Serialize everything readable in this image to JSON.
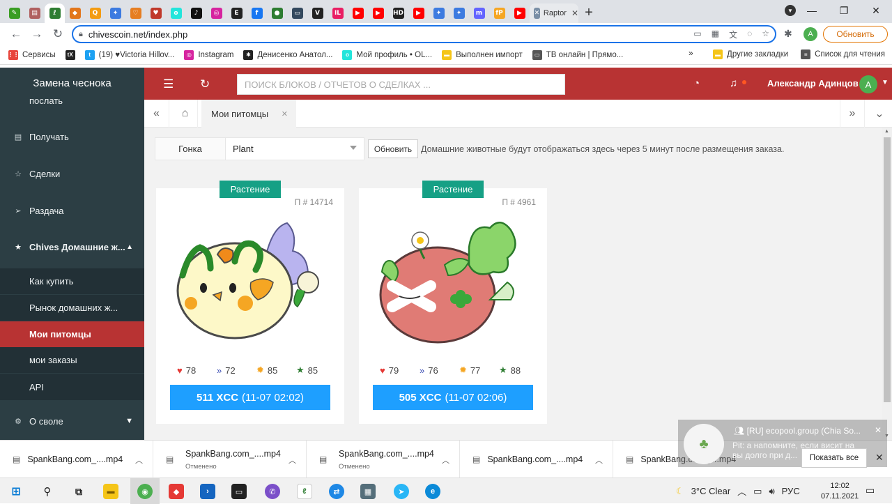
{
  "browser": {
    "tabs": [
      {
        "icon": "tab-favicon-leaf",
        "color": "#3a9d23",
        "glyph": "✎"
      },
      {
        "icon": "tab-favicon-doc",
        "color": "#b06060",
        "glyph": "▤"
      },
      {
        "icon": "tab-favicon-chives",
        "color": "#2e7d32",
        "glyph": "ℓ"
      },
      {
        "icon": "tab-favicon-metamask",
        "color": "#e2761b",
        "glyph": "◆"
      },
      {
        "icon": "tab-favicon-q",
        "color": "#f39c12",
        "glyph": "Q"
      },
      {
        "icon": "tab-favicon-butterfly",
        "color": "#3d7be0",
        "glyph": "✦"
      },
      {
        "icon": "tab-favicon-heart-orange",
        "color": "#e67e22",
        "glyph": "♡"
      },
      {
        "icon": "tab-favicon-heart",
        "color": "#c0392b",
        "glyph": "♥"
      },
      {
        "icon": "tab-favicon-olx",
        "color": "#23e5db",
        "glyph": "o"
      },
      {
        "icon": "tab-favicon-tiktok",
        "color": "#111111",
        "glyph": "♪"
      },
      {
        "icon": "tab-favicon-instagram",
        "color": "#d6249f",
        "glyph": "◎"
      },
      {
        "icon": "tab-favicon-e",
        "color": "#222222",
        "glyph": "E"
      },
      {
        "icon": "tab-favicon-facebook",
        "color": "#1877f2",
        "glyph": "f"
      },
      {
        "icon": "tab-favicon-green",
        "color": "#2e7d32",
        "glyph": "●"
      },
      {
        "icon": "tab-favicon-monitor",
        "color": "#34495e",
        "glyph": "▭"
      },
      {
        "icon": "tab-favicon-v",
        "color": "#222222",
        "glyph": "V"
      },
      {
        "icon": "tab-favicon-il",
        "color": "#e91e63",
        "glyph": "IL"
      },
      {
        "icon": "tab-favicon-youtube",
        "color": "#ff0000",
        "glyph": "▶"
      },
      {
        "icon": "tab-favicon-youtube",
        "color": "#ff0000",
        "glyph": "▶"
      },
      {
        "icon": "tab-favicon-hd",
        "color": "#222222",
        "glyph": "HD"
      },
      {
        "icon": "tab-favicon-youtube",
        "color": "#ff0000",
        "glyph": "▶"
      },
      {
        "icon": "tab-favicon-butterfly",
        "color": "#3d7be0",
        "glyph": "✦"
      },
      {
        "icon": "tab-favicon-butterfly",
        "color": "#3d7be0",
        "glyph": "✦"
      },
      {
        "icon": "tab-favicon-mastodon",
        "color": "#6364ff",
        "glyph": "m"
      },
      {
        "icon": "tab-favicon-fp",
        "color": "#f5a623",
        "glyph": "fP"
      },
      {
        "icon": "tab-favicon-youtube",
        "color": "#ff0000",
        "glyph": "▶"
      }
    ],
    "last_tab_title": "Raptor",
    "url": "chivescoin.net/index.php",
    "profile_initial": "A",
    "update_label": "Обновить",
    "bookmarks": [
      {
        "label": "Сервисы",
        "icon": "apps-grid-icon",
        "color": "#e8453c",
        "glyph": "⋮⋮"
      },
      {
        "label": "",
        "icon": "tx-icon",
        "color": "#222222",
        "glyph": "tX"
      },
      {
        "label": "(19) ♥Victoria Hillov...",
        "icon": "twitter-icon",
        "color": "#1da1f2",
        "glyph": "t"
      },
      {
        "label": "Instagram",
        "icon": "instagram-icon",
        "color": "#d6249f",
        "glyph": "◎"
      },
      {
        "label": "Денисенко Анатол...",
        "icon": "puzzle-icon",
        "color": "#222222",
        "glyph": "✱"
      },
      {
        "label": "Мой профиль • OL...",
        "icon": "olx-icon",
        "color": "#23e5db",
        "glyph": "o"
      },
      {
        "label": "Выполнен импорт",
        "icon": "folder-icon",
        "color": "#f5c518",
        "glyph": "▬"
      },
      {
        "label": "ТВ онлайн | Прямо...",
        "icon": "tv-icon",
        "color": "#555555",
        "glyph": "▭"
      }
    ],
    "bookmarks_right": [
      {
        "label": "Другие закладки",
        "icon": "folder-icon",
        "color": "#f5c518",
        "glyph": "▬"
      },
      {
        "label": "Список для чтения",
        "icon": "reading-list-icon",
        "color": "#555555",
        "glyph": "≡"
      }
    ]
  },
  "app": {
    "brand": "Замена чеснока",
    "search_placeholder": "ПОИСК БЛОКОВ / ОТЧЕТОВ О СДЕЛКАХ ...",
    "user_name": "Александр Адинцов",
    "user_initial": "A",
    "sidebar": {
      "partial_item": "послать",
      "items": [
        {
          "label": "Получать",
          "icon": "receive-icon"
        },
        {
          "label": "Сделки",
          "icon": "star-icon"
        },
        {
          "label": "Раздача",
          "icon": "send-icon"
        },
        {
          "label": "Chives Домашние ж...",
          "icon": "star-icon"
        }
      ],
      "sub_items": [
        "Как купить",
        "Рынок домашних ж...",
        "Мои питомцы",
        "мои заказы",
        "API"
      ],
      "bottom_item": "О своле"
    },
    "tabs": {
      "active": "Мои питомцы"
    },
    "filter": {
      "label": "Гонка",
      "value": "Plant",
      "refresh": "Обновить",
      "note": "Домашние животные будут отображаться здесь через 5 минут после размещения заказа."
    },
    "pets": [
      {
        "badge": "Растение",
        "pid": "П # 14714",
        "hp": "78",
        "speed": "72",
        "energy": "85",
        "luck": "85",
        "price": "511 XCC",
        "time": "(11-07 02:02)"
      },
      {
        "badge": "Растение",
        "pid": "П # 4961",
        "hp": "79",
        "speed": "76",
        "energy": "77",
        "luck": "88",
        "price": "505 XCC",
        "time": "(11-07 02:06)"
      }
    ],
    "colors": {
      "header": "#b83333",
      "sidebar": "#2c3e44",
      "badge": "#16a085",
      "price": "#1e9fff"
    }
  },
  "downloads": {
    "items": [
      {
        "name": "SpankBang.com_....mp4",
        "status": ""
      },
      {
        "name": "SpankBang.com_....mp4",
        "status": "Отменено"
      },
      {
        "name": "SpankBang.com_....mp4",
        "status": "Отменено"
      },
      {
        "name": "SpankBang.com_....mp4",
        "status": ""
      },
      {
        "name": "SpankBang.com_....mp4",
        "status": ""
      }
    ],
    "show_all": "Показать все"
  },
  "toast": {
    "title": "[RU] ecopool.group (Chia So...",
    "body": "Pit: а напомните, если висит на",
    "body2": "вы долго при д..."
  },
  "taskbar": {
    "weather": "3°C  Clear",
    "lang": "РУС",
    "time": "12:02",
    "date": "07.11.2021",
    "notif_count": "1"
  }
}
